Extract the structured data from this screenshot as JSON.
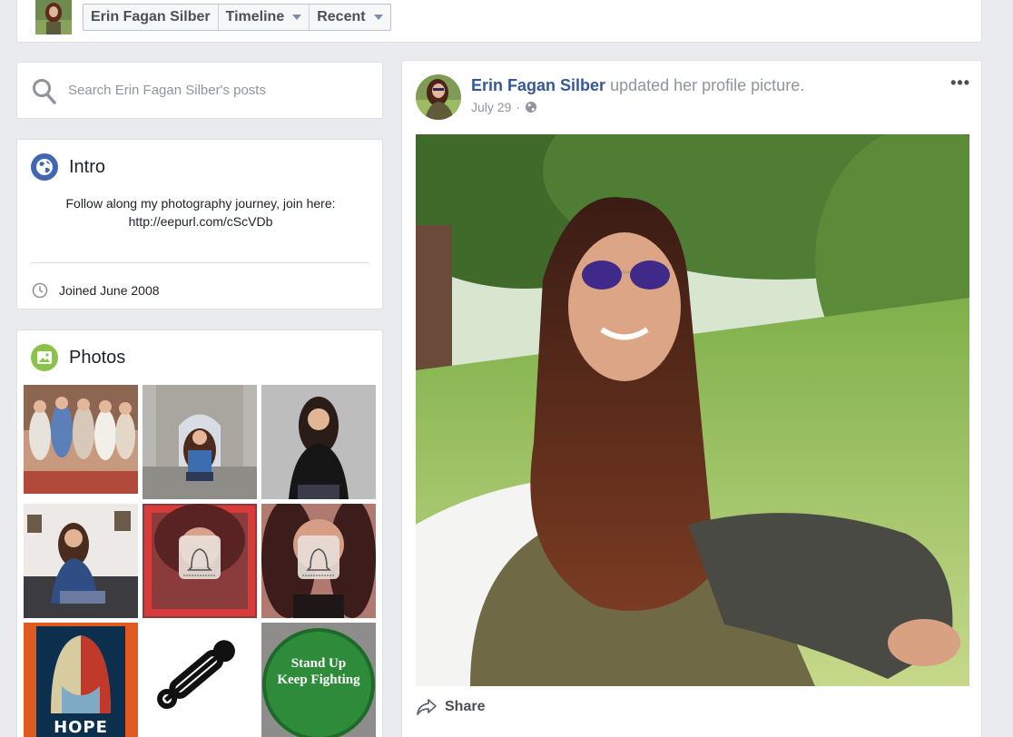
{
  "header": {
    "profile_name": "Erin Fagan Silber",
    "timeline_label": "Timeline",
    "recent_label": "Recent"
  },
  "search": {
    "placeholder": "Search Erin Fagan Silber's posts"
  },
  "intro": {
    "title": "Intro",
    "bio_line1": "Follow along my photography journey, join here:",
    "bio_line2": "http://eepurl.com/cScVDb",
    "joined": "Joined June 2008"
  },
  "photos": {
    "title": "Photos",
    "tiles": [
      {
        "name": "group-photo"
      },
      {
        "name": "arch-photo"
      },
      {
        "name": "black-sweater-photo"
      },
      {
        "name": "couch-photo"
      },
      {
        "name": "ringer-framed-photo"
      },
      {
        "name": "ringer-photo"
      },
      {
        "name": "hope-poster-photo",
        "caption": "HOPE"
      },
      {
        "name": "safety-pin-photo"
      },
      {
        "name": "button-photo",
        "caption_line1": "Stand Up",
        "caption_line2": "Keep Fighting"
      }
    ],
    "ringer_label": "Ringer"
  },
  "post": {
    "author": "Erin Fagan Silber",
    "action": "updated her profile picture.",
    "date": "July 29",
    "separator": "·",
    "more_label": "•••",
    "share_label": "Share"
  },
  "colors": {
    "link_blue": "#365899",
    "page_bg": "#e9ebee",
    "intro_icon": "#4267b2",
    "photos_icon": "#8bc34a",
    "button_green": "#2e8b3a"
  }
}
